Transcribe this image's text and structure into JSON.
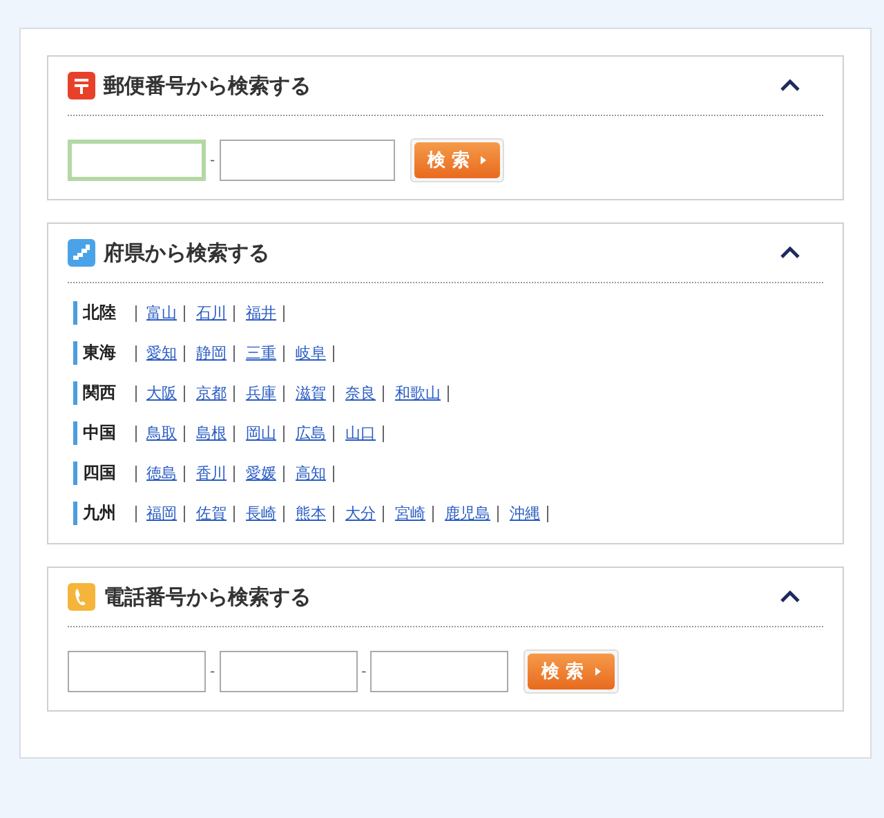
{
  "sections": [
    {
      "kind": "postal",
      "title": "郵便番号から検索する",
      "expanded": true,
      "separator": "-",
      "fields": [
        {
          "focused": true
        },
        {
          "focused": false
        }
      ],
      "button": "検 索"
    },
    {
      "kind": "regions",
      "title": "府県から検索する",
      "expanded": true,
      "regions": [
        {
          "name": "北陸",
          "prefectures": [
            "富山",
            "石川",
            "福井"
          ]
        },
        {
          "name": "東海",
          "prefectures": [
            "愛知",
            "静岡",
            "三重",
            "岐阜"
          ]
        },
        {
          "name": "関西",
          "prefectures": [
            "大阪",
            "京都",
            "兵庫",
            "滋賀",
            "奈良",
            "和歌山"
          ]
        },
        {
          "name": "中国",
          "prefectures": [
            "鳥取",
            "島根",
            "岡山",
            "広島",
            "山口"
          ]
        },
        {
          "name": "四国",
          "prefectures": [
            "徳島",
            "香川",
            "愛媛",
            "高知"
          ]
        },
        {
          "name": "九州",
          "prefectures": [
            "福岡",
            "佐賀",
            "長崎",
            "熊本",
            "大分",
            "宮崎",
            "鹿児島",
            "沖縄"
          ]
        }
      ]
    },
    {
      "kind": "phone",
      "title": "電話番号から検索する",
      "expanded": true,
      "separator": "-",
      "fields": [
        {
          "focused": false
        },
        {
          "focused": false
        },
        {
          "focused": false
        }
      ],
      "button": "検 索"
    }
  ]
}
